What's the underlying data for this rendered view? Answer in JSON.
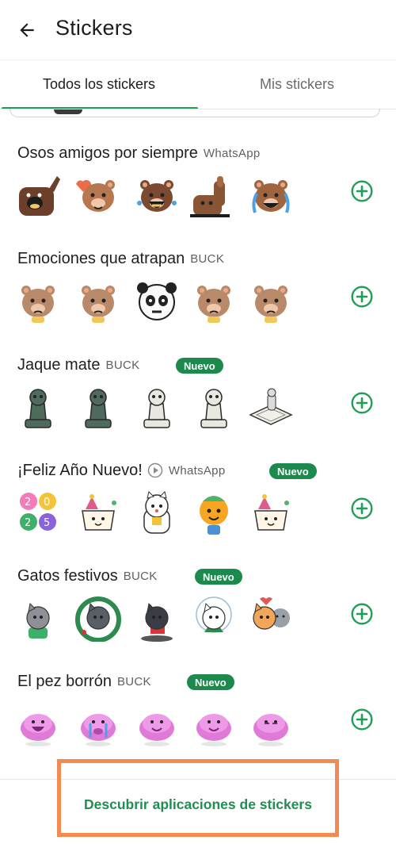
{
  "appbar": {
    "title": "Stickers"
  },
  "tabs": [
    {
      "label": "Todos los stickers",
      "selected": true
    },
    {
      "label": "Mis stickers",
      "selected": false
    }
  ],
  "colors": {
    "accent": "#1f9e55",
    "badge": "#1b8a4c",
    "highlight": "#f28a52"
  },
  "packs": [
    {
      "name": "Osos amigos por siempre",
      "publisher": "WhatsApp",
      "badge": null,
      "animated": false,
      "stickers": [
        "bear-waving-icon",
        "bear-heart-icon",
        "bear-crying-laugh-icon",
        "bear-thumbs-up-icon",
        "bear-crying-icon"
      ]
    },
    {
      "name": "Emociones que atrapan",
      "publisher": "BUCK",
      "badge": null,
      "animated": false,
      "stickers": [
        "bear-teary-icon",
        "bear-boxing-icon",
        "panda-angry-icon",
        "bear-shocked-icon",
        "bear-sad-icon"
      ]
    },
    {
      "name": "Jaque mate",
      "publisher": "BUCK",
      "badge": "Nuevo",
      "animated": false,
      "stickers": [
        "chess-knight-icon",
        "chess-pawns-icon",
        "chess-queen-icon",
        "chess-pawn-icon",
        "chess-board-icon"
      ]
    },
    {
      "name": "¡Feliz Año Nuevo!",
      "publisher": "WhatsApp",
      "badge": "Nuevo",
      "animated": true,
      "stickers": [
        "2025-balloons-icon",
        "party-cup-icon",
        "lucky-cat-icon",
        "orange-character-icon",
        "cup-party-hat-icon"
      ]
    },
    {
      "name": "Gatos festivos",
      "publisher": "BUCK",
      "badge": "Nuevo",
      "animated": false,
      "stickers": [
        "gray-cat-icon",
        "wreath-cat-icon",
        "cat-gift-icon",
        "snow-globe-cat-icon",
        "cats-hug-icon"
      ]
    },
    {
      "name": "El pez borrón",
      "publisher": "BUCK",
      "badge": "Nuevo",
      "animated": false,
      "stickers": [
        "blobfish-laugh-icon",
        "blobfish-cry-icon",
        "blobfish-happy-icon",
        "blobfish-dance-icon",
        "blobfish-sleepy-icon"
      ]
    }
  ],
  "bottom": {
    "discover_label": "Descubrir aplicaciones de stickers"
  }
}
